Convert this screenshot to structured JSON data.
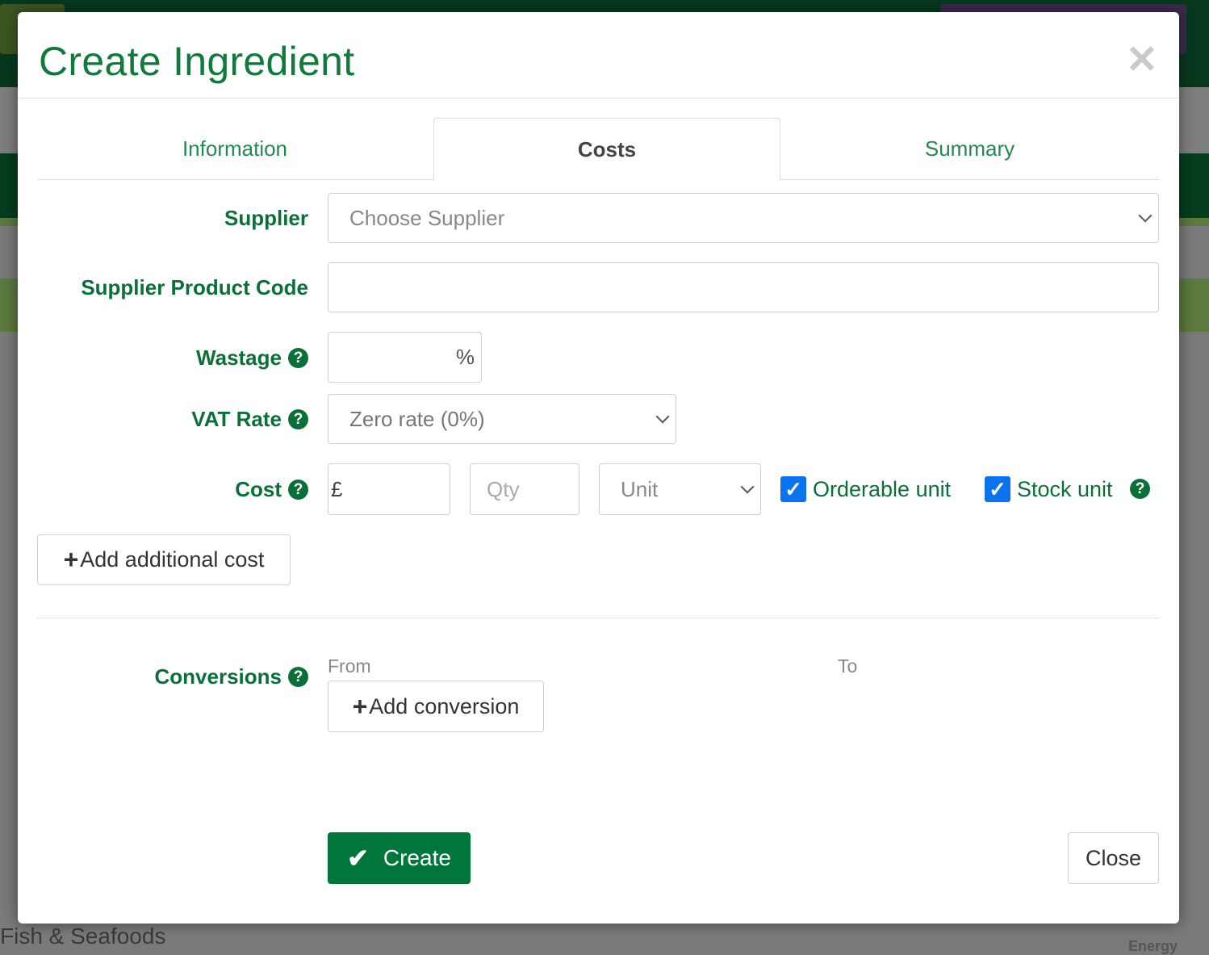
{
  "modal": {
    "title": "Create Ingredient",
    "close_icon": "times-icon",
    "tabs": [
      {
        "label": "Information",
        "active": false
      },
      {
        "label": "Costs",
        "active": true
      },
      {
        "label": "Summary",
        "active": false
      }
    ],
    "supplier": {
      "label": "Supplier",
      "placeholder": "Choose Supplier"
    },
    "supplier_product_code": {
      "label": "Supplier Product Code",
      "value": ""
    },
    "wastage": {
      "label": "Wastage",
      "value": "",
      "suffix": "%"
    },
    "vat_rate": {
      "label": "VAT Rate",
      "selected": "Zero rate (0%)"
    },
    "cost": {
      "label": "Cost",
      "currency_prefix": "£",
      "qty_placeholder": "Qty",
      "unit_placeholder": "Unit",
      "orderable_unit": {
        "label": "Orderable unit",
        "checked": true
      },
      "stock_unit": {
        "label": "Stock unit",
        "checked": true
      }
    },
    "add_additional_cost": "Add additional cost",
    "conversions": {
      "label": "Conversions",
      "from": "From",
      "to": "To",
      "add_button": "Add conversion"
    },
    "create_button": "Create",
    "close_button": "Close"
  },
  "background": {
    "fragment_category": "Fish & Seafoods",
    "fragment_column": "Energy"
  },
  "colors": {
    "brand_green": "#00763a",
    "checkbox_blue": "#0a73f0"
  }
}
